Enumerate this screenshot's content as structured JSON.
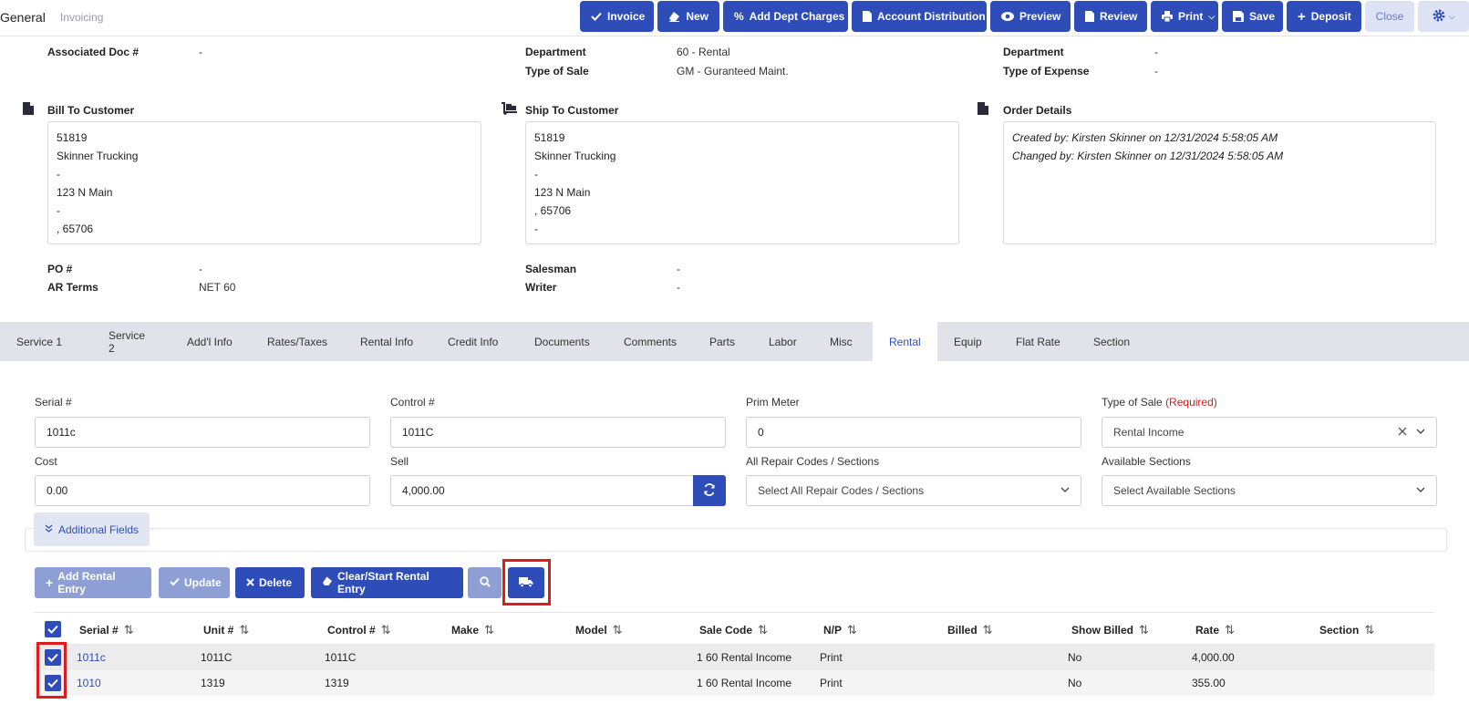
{
  "topbar": {
    "title": "General",
    "subtitle": "Invoicing",
    "buttons": [
      {
        "label": "Invoice",
        "icon": "check-icon"
      },
      {
        "label": "New",
        "icon": "eraser-icon"
      },
      {
        "label": "Add Dept Charges",
        "icon": "percent-icon"
      },
      {
        "label": "Account Distribution",
        "icon": "document-icon"
      },
      {
        "label": "Preview",
        "icon": "eye-icon"
      },
      {
        "label": "Review",
        "icon": "file-icon"
      },
      {
        "label": "Print",
        "icon": "print-icon"
      },
      {
        "label": "Save",
        "icon": "save-icon"
      },
      {
        "label": "Deposit",
        "icon": "plus-icon"
      },
      {
        "label": "Close",
        "icon": ""
      }
    ]
  },
  "header": {
    "associated_doc_label": "Associated Doc #",
    "associated_doc_value": "-",
    "department_label": "Department",
    "department_value": "60 - Rental",
    "type_of_sale_label": "Type of Sale",
    "type_of_sale_value": "GM - Guranteed Maint.",
    "department2_label": "Department",
    "department2_value": "-",
    "type_of_expense_label": "Type of Expense",
    "type_of_expense_value": "-",
    "bill_to_title": "Bill To Customer",
    "bill_to_lines": [
      "51819",
      "Skinner Trucking",
      "-",
      "123 N Main",
      "-",
      ", 65706"
    ],
    "ship_to_title": "Ship To Customer",
    "ship_to_lines": [
      "51819",
      "Skinner Trucking",
      "-",
      "123 N Main",
      ", 65706",
      "-"
    ],
    "order_details_title": "Order Details",
    "order_details_lines": [
      "Created by: Kirsten Skinner on 12/31/2024 5:58:05 AM",
      "Changed by: Kirsten Skinner on 12/31/2024 5:58:05 AM"
    ],
    "po_label": "PO #",
    "po_value": "-",
    "ar_terms_label": "AR Terms",
    "ar_terms_value": "NET 60",
    "salesman_label": "Salesman",
    "salesman_value": "-",
    "writer_label": "Writer",
    "writer_value": "-"
  },
  "tabs": [
    "Service 1",
    "Service 2",
    "Add'l Info",
    "Rates/Taxes",
    "Rental Info",
    "Credit Info",
    "Documents",
    "Comments",
    "Parts",
    "Labor",
    "Misc",
    "Rental",
    "Equip",
    "Flat Rate",
    "Section"
  ],
  "active_tab": "Rental",
  "form": {
    "serial_label": "Serial #",
    "serial_value": "1011c",
    "control_label": "Control #",
    "control_value": "1011C",
    "prim_meter_label": "Prim Meter",
    "prim_meter_value": "0",
    "type_of_sale_label": "Type of Sale",
    "type_of_sale_required": "(Required)",
    "type_of_sale_value": "Rental Income",
    "cost_label": "Cost",
    "cost_value": "0.00",
    "sell_label": "Sell",
    "sell_value": "4,000.00",
    "repair_codes_label": "All Repair Codes / Sections",
    "repair_codes_placeholder": "Select All Repair Codes / Sections",
    "available_sections_label": "Available Sections",
    "available_sections_placeholder": "Select Available Sections",
    "additional_fields_label": "Additional Fields"
  },
  "actions": {
    "add_rental_entry": "Add Rental Entry",
    "update": "Update",
    "delete": "Delete",
    "clear_start": "Clear/Start Rental Entry"
  },
  "table": {
    "columns": [
      "Serial #",
      "Unit #",
      "Control #",
      "Make",
      "Model",
      "Sale Code",
      "N/P",
      "Billed",
      "Show Billed",
      "Rate",
      "Section"
    ],
    "rows": [
      [
        "1011c",
        "1011C",
        "1011C",
        "",
        "",
        "1 60 Rental Income",
        "Print",
        "",
        "No",
        "4,000.00",
        ""
      ],
      [
        "1010",
        "1319",
        "1319",
        "",
        "",
        "1 60 Rental Income",
        "Print",
        "",
        "No",
        "355.00",
        ""
      ]
    ]
  },
  "colors": {
    "primary": "#2f4db8",
    "highlight": "#e01b1b",
    "tab_bar": "#e2e2ea"
  }
}
